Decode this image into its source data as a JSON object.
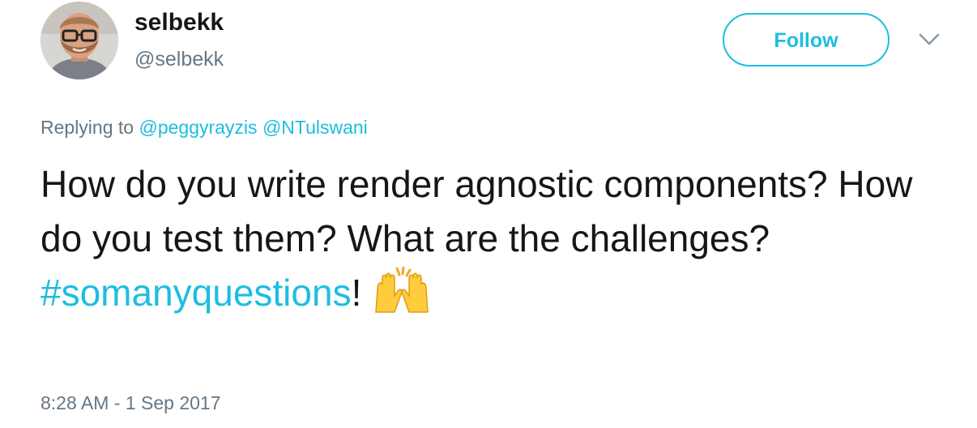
{
  "tweet": {
    "author": {
      "display_name": "selbekk",
      "screen_name": "@selbekk"
    },
    "follow_label": "Follow",
    "reply": {
      "prefix": "Replying to",
      "mentions": [
        "@peggyrayzis",
        "@NTulswani"
      ]
    },
    "body": {
      "text": "How do you write render agnostic components? How do you test them? What are the challenges?",
      "hashtag": "#somanyquestions",
      "suffix": "!",
      "emoji": "raising-hands-emoji"
    },
    "timestamp": "8:28 AM - 1 Sep 2017"
  },
  "colors": {
    "accent": "#1dbedf",
    "secondary_text": "#657786",
    "primary_text": "#14171a"
  }
}
